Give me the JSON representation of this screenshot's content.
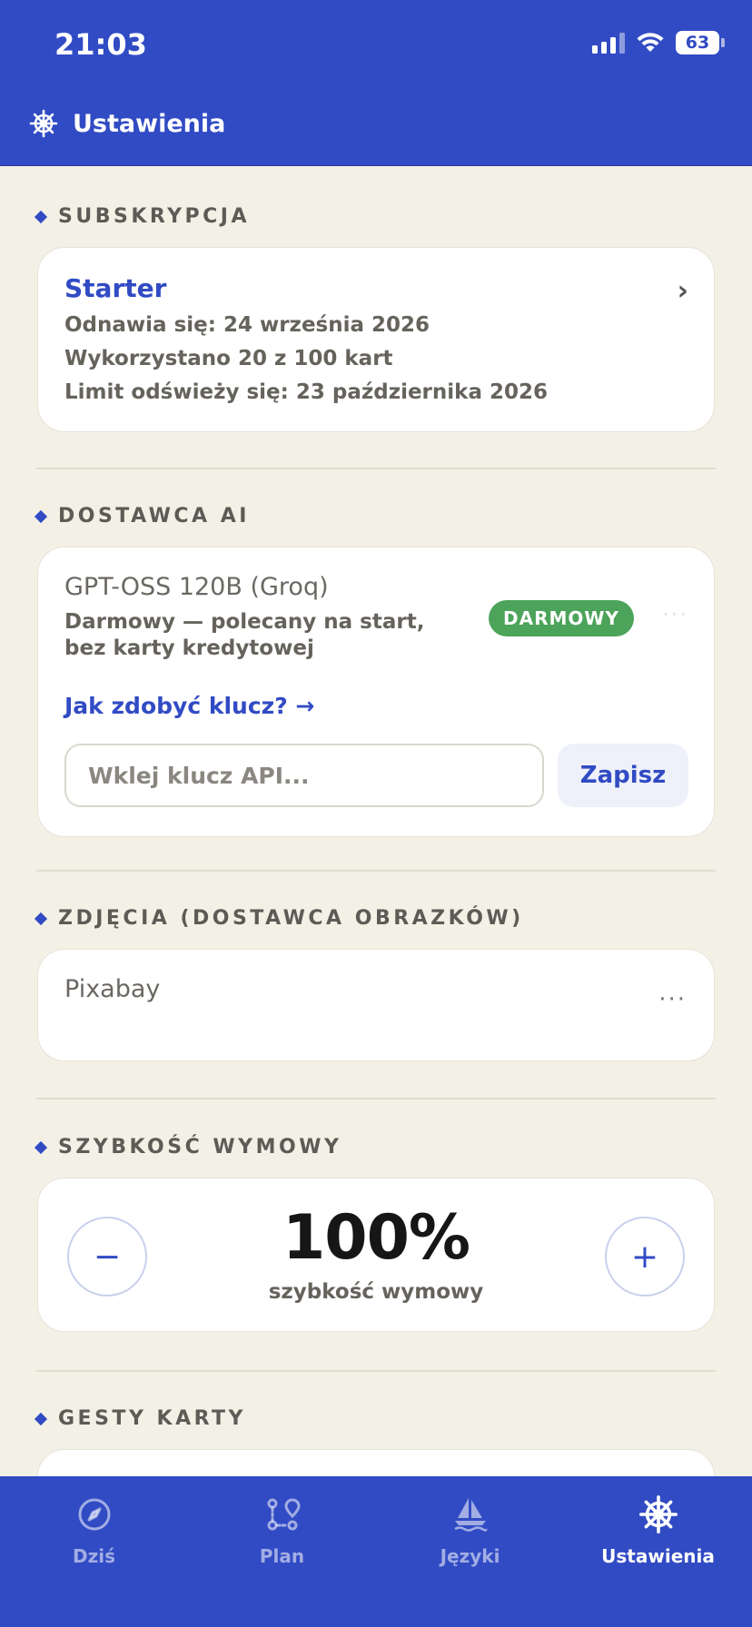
{
  "status_bar": {
    "time": "21:03",
    "battery": "63"
  },
  "header": {
    "title": "Ustawienia"
  },
  "sections": {
    "subscription": {
      "label": "SUBSKRYPCJA",
      "plan": "Starter",
      "renews": "Odnawia się: 24 września 2026",
      "usage": "Wykorzystano 20 z 100 kart",
      "limit_refresh": "Limit odświeży się: 23 października 2026"
    },
    "ai_provider": {
      "label": "DOSTAWCA AI",
      "model": "GPT-OSS 120B (Groq)",
      "description": "Darmowy — polecany na start, bez karty kredytowej",
      "badge": "DARMOWY",
      "key_link": "Jak zdobyć klucz? →",
      "api_placeholder": "Wklej klucz API...",
      "save_label": "Zapisz"
    },
    "images": {
      "label": "ZDJĘCIA (DOSTAWCA OBRAZKÓW)",
      "provider": "Pixabay",
      "more": "···"
    },
    "speech_speed": {
      "label": "SZYBKOŚĆ WYMOWY",
      "value": "100%",
      "caption": "szybkość wymowy",
      "minus": "−",
      "plus": "+"
    },
    "card_gestures": {
      "label": "GESTY KARTY"
    }
  },
  "tabs": [
    {
      "label": "Dziś",
      "icon": "compass-icon",
      "active": false
    },
    {
      "label": "Plan",
      "icon": "route-icon",
      "active": false
    },
    {
      "label": "Języki",
      "icon": "sailboat-icon",
      "active": false
    },
    {
      "label": "Ustawienia",
      "icon": "ship-wheel-icon",
      "active": true
    }
  ],
  "colors": {
    "primary": "#314BC4",
    "background": "#F3F0E6",
    "badge_green": "#4CA35A"
  }
}
